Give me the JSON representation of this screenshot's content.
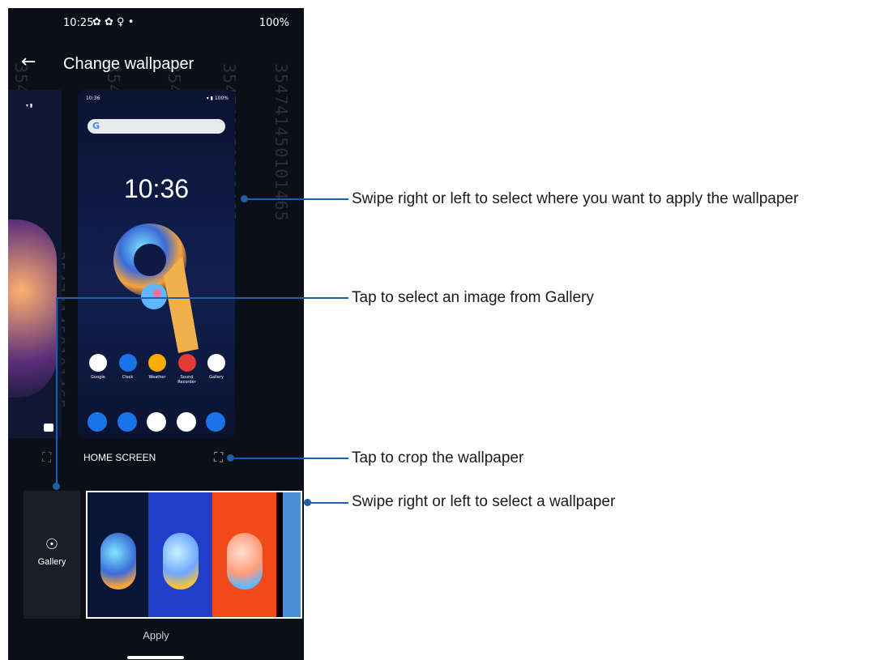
{
  "status_bar": {
    "time": "10:25",
    "left_icons": "✿ ✿ ♀ •",
    "battery": "100%"
  },
  "app_bar": {
    "back_icon": "arrow-left-icon",
    "title": "Change wallpaper"
  },
  "preview": {
    "status_time": "10:36",
    "status_right": "▾ ▮ 100%",
    "clock": "10:36",
    "apps": [
      {
        "label": "Google",
        "color": "#ffffff"
      },
      {
        "label": "Clock",
        "color": "#1a73e8"
      },
      {
        "label": "Weather",
        "color": "#f9ab00"
      },
      {
        "label": "Sound Recorder",
        "color": "#e53935"
      },
      {
        "label": "Gallery",
        "color": "#ffffff"
      }
    ],
    "dock_colors": [
      "#1a73e8",
      "#1a73e8",
      "#ffffff",
      "#ffffff",
      "#1a73e8"
    ],
    "label": "HOME SCREEN"
  },
  "gallery_tile": {
    "label": "Gallery",
    "icon": "lightbulb-icon"
  },
  "thumbnails": [
    {
      "bg": "#0a1638"
    },
    {
      "bg": "#1f3fc9"
    },
    {
      "bg": "#f04a1a"
    },
    {
      "bg": "#4a8fd8"
    }
  ],
  "apply_label": "Apply",
  "callouts": {
    "swipe_apply": "Swipe right or left to select where you want to apply the wallpaper",
    "tap_gallery": "Tap to select an image from Gallery",
    "tap_crop": "Tap to crop the wallpaper",
    "swipe_select": "Swipe right or left to select a wallpaper"
  },
  "watermark": "354741450101465"
}
